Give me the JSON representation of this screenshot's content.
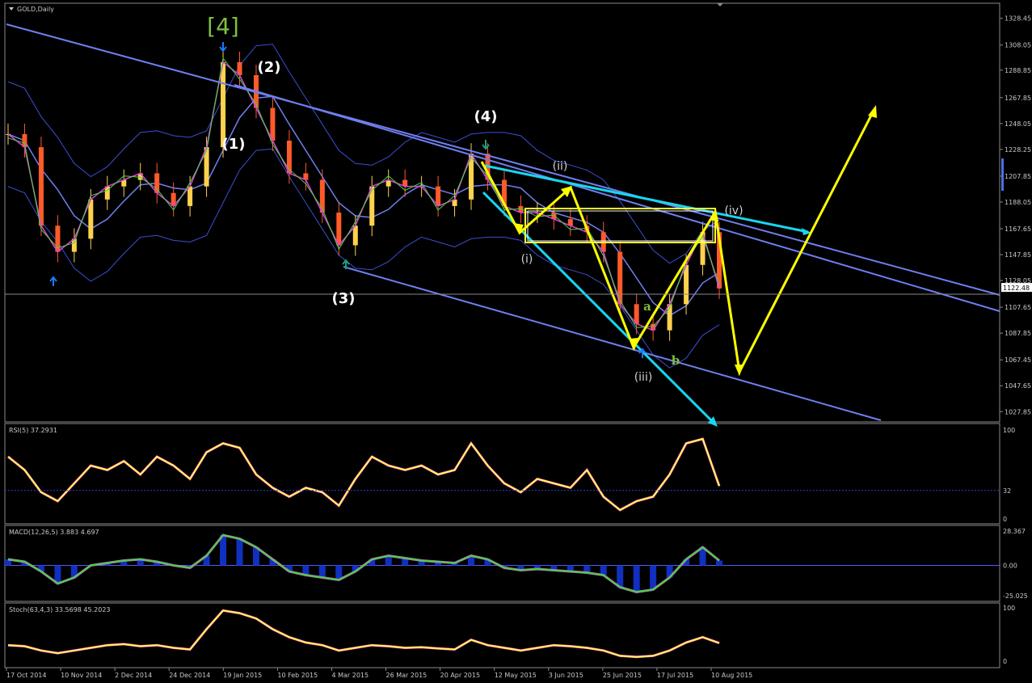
{
  "chart_data": [
    {
      "type": "line",
      "title": "GOLD,Daily",
      "price_axis": {
        "ticks": [
          "1328.45",
          "1308.05",
          "1288.85",
          "1267.85",
          "1248.05",
          "1228.25",
          "1207.85",
          "1188.05",
          "1167.65",
          "1147.85",
          "1128.05",
          "1107.65",
          "1087.85",
          "1067.45",
          "1047.65",
          "1027.85"
        ],
        "current_price_label": "1122.48",
        "ylim": [
          1020,
          1340
        ]
      },
      "date_axis": {
        "ticks": [
          "17 Oct 2014",
          "10 Nov 2014",
          "2 Dec 2014",
          "24 Dec 2014",
          "19 Jan 2015",
          "10 Feb 2015",
          "4 Mar 2015",
          "26 Mar 2015",
          "20 Apr 2015",
          "12 May 2015",
          "3 Jun 2015",
          "25 Jun 2015",
          "17 Jul 2015",
          "10 Aug 2015"
        ]
      },
      "close_series": [
        {
          "date": "17 Oct 2014",
          "close": 1240
        },
        {
          "date": "24 Oct 2014",
          "close": 1230
        },
        {
          "date": "31 Oct 2014",
          "close": 1170
        },
        {
          "date": "7 Nov 2014",
          "close": 1150
        },
        {
          "date": "10 Nov 2014",
          "close": 1160
        },
        {
          "date": "17 Nov 2014",
          "close": 1190
        },
        {
          "date": "24 Nov 2014",
          "close": 1200
        },
        {
          "date": "2 Dec 2014",
          "close": 1205
        },
        {
          "date": "9 Dec 2014",
          "close": 1210
        },
        {
          "date": "16 Dec 2014",
          "close": 1195
        },
        {
          "date": "24 Dec 2014",
          "close": 1185
        },
        {
          "date": "2 Jan 2015",
          "close": 1200
        },
        {
          "date": "9 Jan 2015",
          "close": 1230
        },
        {
          "date": "19 Jan 2015",
          "close": 1295
        },
        {
          "date": "26 Jan 2015",
          "close": 1285
        },
        {
          "date": "2 Feb 2015",
          "close": 1260
        },
        {
          "date": "10 Feb 2015",
          "close": 1235
        },
        {
          "date": "17 Feb 2015",
          "close": 1210
        },
        {
          "date": "24 Feb 2015",
          "close": 1205
        },
        {
          "date": "4 Mar 2015",
          "close": 1180
        },
        {
          "date": "11 Mar 2015",
          "close": 1155
        },
        {
          "date": "18 Mar 2015",
          "close": 1170
        },
        {
          "date": "26 Mar 2015",
          "close": 1200
        },
        {
          "date": "2 Apr 2015",
          "close": 1205
        },
        {
          "date": "9 Apr 2015",
          "close": 1200
        },
        {
          "date": "20 Apr 2015",
          "close": 1200
        },
        {
          "date": "27 Apr 2015",
          "close": 1185
        },
        {
          "date": "4 May 2015",
          "close": 1190
        },
        {
          "date": "12 May 2015",
          "close": 1225
        },
        {
          "date": "19 May 2015",
          "close": 1205
        },
        {
          "date": "26 May 2015",
          "close": 1185
        },
        {
          "date": "3 Jun 2015",
          "close": 1180
        },
        {
          "date": "10 Jun 2015",
          "close": 1180
        },
        {
          "date": "17 Jun 2015",
          "close": 1175
        },
        {
          "date": "25 Jun 2015",
          "close": 1170
        },
        {
          "date": "2 Jul 2015",
          "close": 1165
        },
        {
          "date": "9 Jul 2015",
          "close": 1150
        },
        {
          "date": "17 Jul 2015",
          "close": 1110
        },
        {
          "date": "24 Jul 2015",
          "close": 1095
        },
        {
          "date": "31 Jul 2015",
          "close": 1090
        },
        {
          "date": "10 Aug 2015",
          "close": 1110
        },
        {
          "date": "17 Aug 2015",
          "close": 1140
        },
        {
          "date": "24 Aug 2015",
          "close": 1165
        },
        {
          "date": "27 Aug 2015",
          "close": 1122
        }
      ],
      "wave_labels": [
        "[4]",
        "(1)",
        "(2)",
        "(3)",
        "(4)",
        "(i)",
        "(ii)",
        "(iii)",
        "(iv)",
        "a",
        "b"
      ]
    },
    {
      "type": "line",
      "title": "RSI(5) 37.2931",
      "y_ticks": [
        "100",
        "32",
        "0"
      ],
      "level": 32,
      "values": [
        70,
        55,
        30,
        20,
        40,
        60,
        55,
        65,
        50,
        70,
        60,
        45,
        75,
        85,
        80,
        50,
        35,
        25,
        35,
        30,
        15,
        45,
        70,
        60,
        55,
        60,
        50,
        55,
        85,
        60,
        40,
        30,
        45,
        40,
        35,
        55,
        25,
        10,
        20,
        25,
        50,
        85,
        90,
        37
      ]
    },
    {
      "type": "line",
      "title": "MACD(12,26,5) 3.883 4.697",
      "y_ticks": [
        "28.367",
        "0.00",
        "-25.025"
      ],
      "values": [
        5,
        3,
        -5,
        -15,
        -10,
        0,
        2,
        4,
        5,
        3,
        0,
        -2,
        8,
        25,
        22,
        15,
        5,
        -5,
        -8,
        -10,
        -12,
        -5,
        5,
        8,
        6,
        4,
        3,
        2,
        8,
        5,
        -2,
        -4,
        -3,
        -4,
        -5,
        -6,
        -8,
        -18,
        -22,
        -20,
        -10,
        5,
        15,
        4
      ]
    },
    {
      "type": "line",
      "title": "Stoch(63,4,3) 33.5698 45.2023",
      "y_ticks": [
        "100",
        "0"
      ],
      "values": [
        30,
        28,
        20,
        15,
        20,
        25,
        30,
        32,
        28,
        30,
        25,
        22,
        60,
        95,
        90,
        80,
        60,
        45,
        35,
        30,
        20,
        25,
        30,
        28,
        25,
        26,
        24,
        22,
        40,
        30,
        25,
        20,
        25,
        30,
        28,
        25,
        20,
        10,
        8,
        10,
        20,
        35,
        45,
        34
      ]
    }
  ]
}
